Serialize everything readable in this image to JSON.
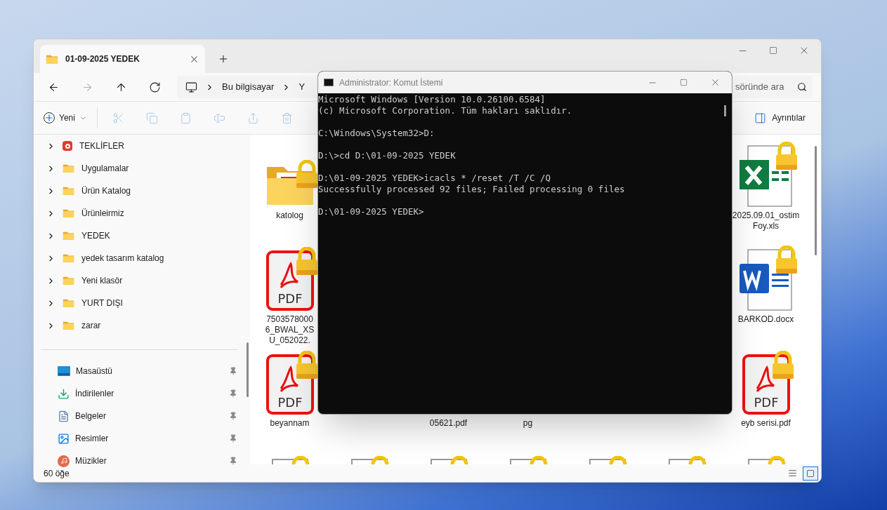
{
  "explorer": {
    "tabs": [
      {
        "title": "01-09-2025 YEDEK",
        "selected": true
      }
    ],
    "nav": [
      {
        "kind": "back",
        "disabled": false
      },
      {
        "kind": "forward",
        "disabled": true
      },
      {
        "kind": "up",
        "disabled": false
      },
      {
        "kind": "refresh",
        "disabled": false
      }
    ],
    "breadcrumbs": [
      "Bu bilgisayar",
      "Y"
    ],
    "search": {
      "placeholder": "söründe ara"
    },
    "toolbar": {
      "new_label": "Yeni",
      "actions": [
        {
          "kind": "cut",
          "disabled": true
        },
        {
          "kind": "copy",
          "disabled": true
        },
        {
          "kind": "paste",
          "disabled": true
        },
        {
          "kind": "rename",
          "disabled": true
        },
        {
          "kind": "share",
          "disabled": true
        },
        {
          "kind": "delete",
          "disabled": true
        }
      ],
      "details_label": "Ayrıntılar"
    },
    "sidebar": {
      "folders": [
        {
          "label": "TEKLİFLER",
          "kind": "app",
          "expanded": false
        },
        {
          "label": "Uygulamalar",
          "kind": "folder",
          "expanded": false
        },
        {
          "label": "Ürün Katalog",
          "kind": "folder",
          "expanded": false
        },
        {
          "label": "Ürünleirmiz",
          "kind": "folder",
          "expanded": false
        },
        {
          "label": "YEDEK",
          "kind": "folder",
          "expanded": false
        },
        {
          "label": "yedek tasarım katalog",
          "kind": "folder",
          "expanded": false
        },
        {
          "label": "Yeni klasör",
          "kind": "folder",
          "expanded": false
        },
        {
          "label": "YURT DIŞI",
          "kind": "folder",
          "expanded": false
        },
        {
          "label": "zarar",
          "kind": "folder",
          "expanded": false
        }
      ],
      "quick_access": [
        {
          "label": "Masaüstü",
          "kind": "desktop",
          "pinned": true
        },
        {
          "label": "İndirilenler",
          "kind": "downloads",
          "pinned": true
        },
        {
          "label": "Belgeler",
          "kind": "documents",
          "pinned": true
        },
        {
          "label": "Resimler",
          "kind": "pictures",
          "pinned": true
        },
        {
          "label": "Müzikler",
          "kind": "music",
          "pinned": true
        }
      ]
    },
    "files": {
      "rows": [
        [
          {
            "kind": "folder",
            "locked": true,
            "lines": [
              "katolog"
            ]
          },
          null,
          null,
          null,
          null,
          null,
          {
            "kind": "excel",
            "locked": true,
            "lines": [
              "2025.09.01_ostim",
              "Foy.xls"
            ]
          }
        ],
        [
          {
            "kind": "pdf",
            "locked": true,
            "icon_text": "PDF",
            "lines": [
              "7503578000",
              "6_BWAL_XS",
              "U_052022."
            ]
          },
          null,
          null,
          null,
          null,
          null,
          {
            "kind": "word",
            "locked": true,
            "lines": [
              "BARKOD.docx"
            ]
          }
        ],
        [
          {
            "kind": "pdf",
            "locked": true,
            "icon_text": "PDF",
            "lines": [
              "beyannam"
            ]
          },
          null,
          {
            "lines": [
              "05621.pdf"
            ]
          },
          {
            "lines": [
              "pg"
            ]
          },
          null,
          null,
          {
            "kind": "pdf",
            "locked": true,
            "icon_text": "PDF",
            "lines": [
              "eyb serisi.pdf"
            ]
          }
        ],
        [
          {
            "kind": "file",
            "locked": true
          },
          {
            "kind": "file",
            "locked": true
          },
          {
            "kind": "file",
            "locked": true
          },
          {
            "kind": "file",
            "locked": true
          },
          {
            "kind": "file",
            "locked": true
          },
          {
            "kind": "file",
            "locked": true
          },
          {
            "kind": "file",
            "locked": true
          }
        ]
      ]
    },
    "status_bar": {
      "count": "60 öğe",
      "views": [
        {
          "kind": "details",
          "selected": false
        },
        {
          "kind": "tiles",
          "selected": true
        }
      ]
    }
  },
  "console": {
    "title": "Administrator: Komut İstemi",
    "blocks": [
      [
        "Microsoft Windows [Version 10.0.26100.6584]",
        "(c) Microsoft Corporation. Tüm hakları saklıdır."
      ],
      [
        "C:\\Windows\\System32>D:"
      ],
      [
        "D:\\>cd D:\\01-09-2025 YEDEK"
      ],
      [
        "D:\\01-09-2025 YEDEK>icacls * /reset /T /C /Q",
        "Successfully processed 92 files; Failed processing 0 files"
      ],
      [
        "D:\\01-09-2025 YEDEK>"
      ]
    ]
  }
}
